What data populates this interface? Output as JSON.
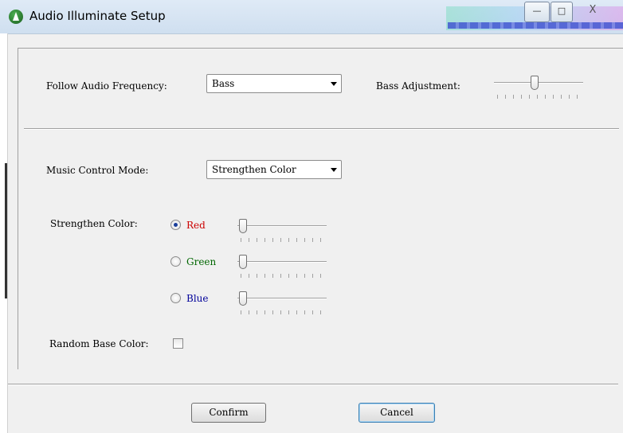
{
  "window": {
    "title": "Audio Illuminate Setup",
    "controls": {
      "minimize": "—",
      "maximize": "□",
      "close": "X"
    }
  },
  "frequency": {
    "label": "Follow Audio Frequency:",
    "selected": "Bass",
    "adjust_label": "Bass Adjustment:",
    "adjust_value": 0.45
  },
  "mode": {
    "label": "Music Control Mode:",
    "selected": "Strengthen Color"
  },
  "strengthen": {
    "label": "Strengthen Color:",
    "options": [
      {
        "label": "Red",
        "color": "#cc0000",
        "selected": true,
        "value": 0
      },
      {
        "label": "Green",
        "color": "#006600",
        "selected": false,
        "value": 0
      },
      {
        "label": "Blue",
        "color": "#000099",
        "selected": false,
        "value": 0
      }
    ]
  },
  "random": {
    "label": "Random Base Color:",
    "checked": false
  },
  "buttons": {
    "confirm": "Confirm",
    "cancel": "Cancel"
  },
  "colors": {
    "accent": "#3c7fb1",
    "background": "#f0f0f0"
  }
}
